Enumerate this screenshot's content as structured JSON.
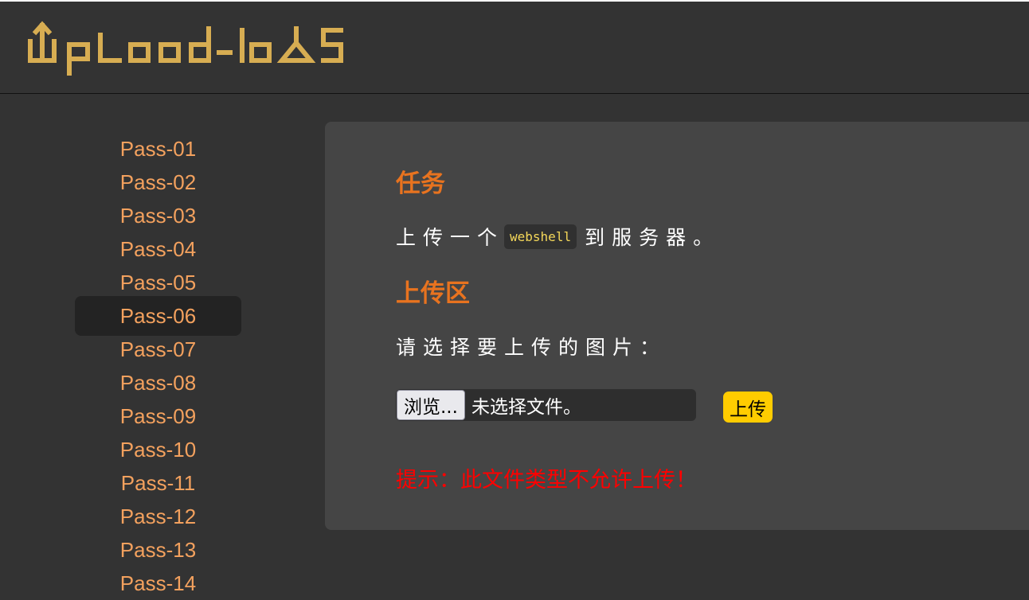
{
  "logo": {
    "text": "UpLoad-labS",
    "color": "#d7ad52"
  },
  "sidebar": {
    "active_index": 5,
    "items": [
      {
        "label": "Pass-01"
      },
      {
        "label": "Pass-02"
      },
      {
        "label": "Pass-03"
      },
      {
        "label": "Pass-04"
      },
      {
        "label": "Pass-05"
      },
      {
        "label": "Pass-06"
      },
      {
        "label": "Pass-07"
      },
      {
        "label": "Pass-08"
      },
      {
        "label": "Pass-09"
      },
      {
        "label": "Pass-10"
      },
      {
        "label": "Pass-11"
      },
      {
        "label": "Pass-12"
      },
      {
        "label": "Pass-13"
      },
      {
        "label": "Pass-14"
      }
    ]
  },
  "main": {
    "task_title": "任务",
    "task_text_before": "上传一个",
    "task_code": "webshell",
    "task_text_after": "到服务器。",
    "upload_title": "上传区",
    "prompt": "请选择要上传的图片：",
    "browse_label": "浏览...",
    "file_status": "未选择文件。",
    "upload_label": "上传",
    "error_message": "提示：此文件类型不允许上传！"
  },
  "colors": {
    "background": "#333333",
    "panel": "#454545",
    "nav_text": "#f3a15e",
    "section_title": "#e8731f",
    "code_text": "#f5d85a",
    "upload_button": "#ffcc00",
    "error": "#ff0000"
  }
}
